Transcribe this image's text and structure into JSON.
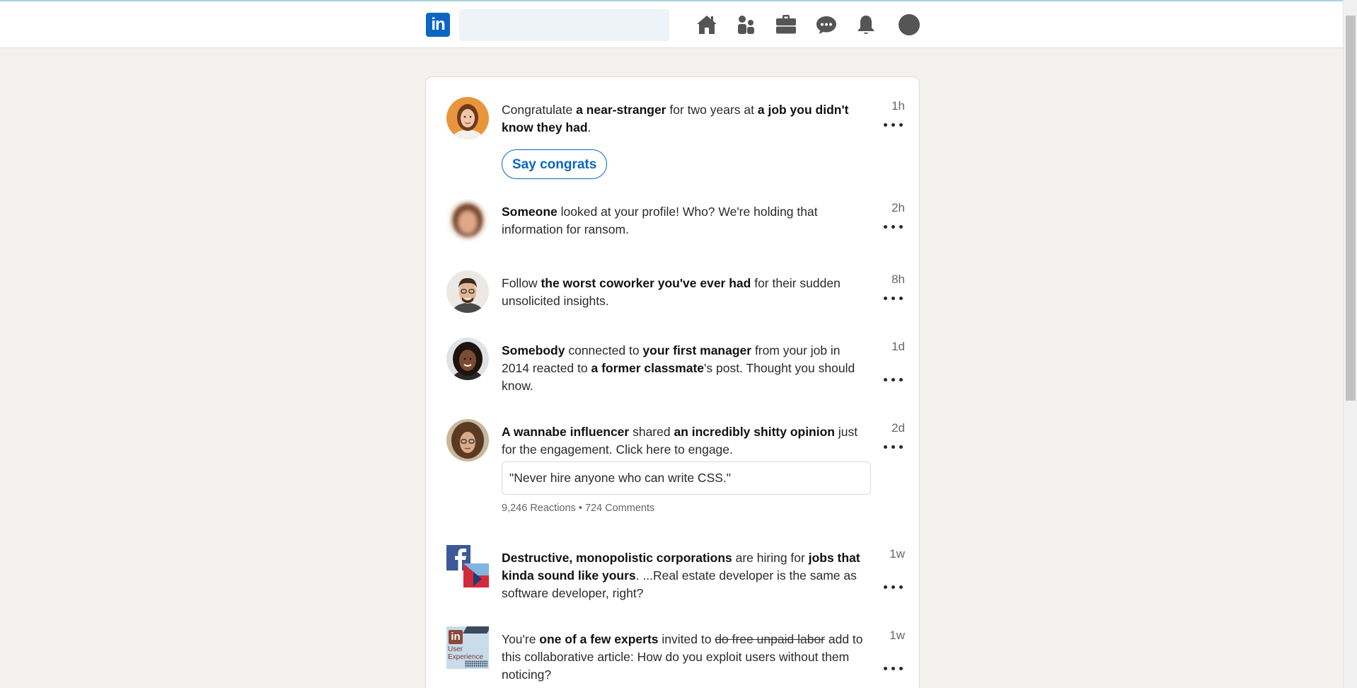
{
  "search": {
    "placeholder": ""
  },
  "nav": [
    "home-icon",
    "people-icon",
    "briefcase-icon",
    "messaging-icon",
    "bell-icon",
    "profile-icon"
  ],
  "logo": "in",
  "notifications": [
    {
      "time": "1h",
      "parts": [
        {
          "t": "Congratulate ",
          "b": false
        },
        {
          "t": "a near-stranger",
          "b": true
        },
        {
          "t": " for two years at ",
          "b": false
        },
        {
          "t": "a job you didn't know they had",
          "b": true
        },
        {
          "t": ".",
          "b": false
        }
      ],
      "button": "Say congrats"
    },
    {
      "time": "2h",
      "parts": [
        {
          "t": "Someone",
          "b": true
        },
        {
          "t": " looked at your profile! Who? We're holding that information for ransom.",
          "b": false
        }
      ]
    },
    {
      "time": "8h",
      "parts": [
        {
          "t": "Follow ",
          "b": false
        },
        {
          "t": "the worst coworker you've ever had",
          "b": true
        },
        {
          "t": " for their sudden unsolicited insights.",
          "b": false
        }
      ]
    },
    {
      "time": "1d",
      "parts": [
        {
          "t": "Somebody",
          "b": true
        },
        {
          "t": " connected to ",
          "b": false
        },
        {
          "t": "your first manager",
          "b": true
        },
        {
          "t": " from your job in 2014 reacted to ",
          "b": false
        },
        {
          "t": "a former classmate",
          "b": true
        },
        {
          "t": "'s post. Thought you should know.",
          "b": false
        }
      ]
    },
    {
      "time": "2d",
      "parts": [
        {
          "t": "A wannabe influencer",
          "b": true
        },
        {
          "t": " shared ",
          "b": false
        },
        {
          "t": "an incredibly shitty opinion",
          "b": true
        },
        {
          "t": " just for the engagement. Click here to engage.",
          "b": false
        }
      ],
      "quote": "\"Never hire anyone who can write CSS.\"",
      "stats": "9,246 Reactions • 724 Comments"
    },
    {
      "time": "1w",
      "parts": [
        {
          "t": "Destructive, monopolistic corporations",
          "b": true
        },
        {
          "t": " are hiring for ",
          "b": false
        },
        {
          "t": "jobs that kinda sound like yours",
          "b": true
        },
        {
          "t": ". ...Real estate developer is the same as software developer, right?",
          "b": false
        }
      ]
    },
    {
      "time": "1w",
      "parts": [
        {
          "t": "You're ",
          "b": false
        },
        {
          "t": "one of a few experts",
          "b": true
        },
        {
          "t": " invited to ",
          "b": false
        },
        {
          "t": "do free unpaid labor",
          "s": true
        },
        {
          "t": " add to this collaborative article: How do you exploit users without them noticing?",
          "b": false
        }
      ],
      "avatar_label_1": "User",
      "avatar_label_2": "Experience",
      "avatar_logo": "in"
    }
  ],
  "colors": {
    "brand": "#0a66c2",
    "background": "#f4f2ee",
    "search_bg": "#edf3f8"
  }
}
